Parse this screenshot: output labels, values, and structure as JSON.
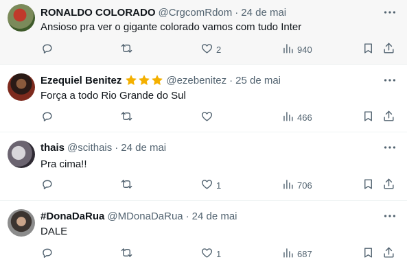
{
  "tweets": [
    {
      "name": "RONALDO COLORADO",
      "handle": "@CrgcomRdom",
      "separator": "·",
      "date": "24 de mai",
      "text": "Ansioso pra ver o gigante colorado vamos com tudo Inter",
      "likes": "2",
      "views": "940",
      "stars": 0
    },
    {
      "name": "Ezequiel Benitez",
      "handle": "@ezebenitez",
      "separator": "·",
      "date": "25 de mai",
      "text": "Força a todo Rio Grande do Sul",
      "likes": "",
      "views": "466",
      "stars": 3
    },
    {
      "name": "thais",
      "handle": "@scithais",
      "separator": "·",
      "date": "24 de mai",
      "text": "Pra cima!!",
      "likes": "1",
      "views": "706",
      "stars": 0
    },
    {
      "name": "#DonaDaRua",
      "handle": "@MDonaDaRua",
      "separator": "·",
      "date": "24 de mai",
      "text": "DALE",
      "likes": "1",
      "views": "687",
      "stars": 0
    }
  ],
  "colors": {
    "text_primary": "#0f1419",
    "text_secondary": "#536471",
    "star": "#f4b000",
    "highlight_row": "#f7f7f7"
  },
  "icons": [
    "reply-icon",
    "retweet-icon",
    "like-icon",
    "views-icon",
    "bookmark-icon",
    "share-icon",
    "more-icon",
    "star-icon"
  ]
}
